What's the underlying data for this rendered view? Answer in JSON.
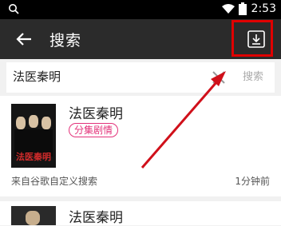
{
  "status_bar": {
    "time": "2:53",
    "icons": [
      "search-icon",
      "wifi-icon",
      "battery-icon"
    ]
  },
  "app_bar": {
    "title": "搜索",
    "back_icon": "arrow-left-icon",
    "download_icon": "download-icon"
  },
  "search": {
    "query": "法医秦明",
    "clear_icon": "close-icon",
    "button_label": "搜索"
  },
  "results": [
    {
      "title": "法医秦明",
      "tag": "分集剧情",
      "source": "来自谷歌自定义搜索",
      "time": "1分钟前",
      "poster_text": "法医秦明"
    },
    {
      "title": "法医秦明"
    }
  ],
  "colors": {
    "app_bar": "#2b2b2b",
    "tag": "#e3327a",
    "highlight": "#e00000"
  }
}
